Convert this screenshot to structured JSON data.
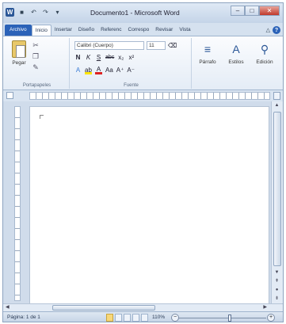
{
  "window": {
    "title": "Documento1 - Microsoft Word",
    "logo": "W",
    "qat_icons": [
      "word-logo",
      "save-icon",
      "undo-icon",
      "redo-icon",
      "customize-icon"
    ],
    "controls": {
      "minimize": "–",
      "maximize": "□",
      "close": "✕"
    }
  },
  "tabs": [
    "Archivo",
    "Inicio",
    "Insertar",
    "Diseño",
    "Referenc",
    "Correspo",
    "Revisar",
    "Vista"
  ],
  "active_tab": "Inicio",
  "ribbon": {
    "clipboard": {
      "paste_label": "Pegar",
      "group_label": "Portapapeles"
    },
    "font": {
      "name": "Calibri (Cuerpo)",
      "size": "11",
      "group_label": "Fuente",
      "row2": [
        "N",
        "K",
        "S",
        "abc",
        "x₂",
        "x²"
      ],
      "row3": [
        "A",
        "ab",
        "A",
        "Aa",
        "A⁺",
        "A⁻"
      ]
    },
    "paragraph": {
      "label": "Párrafo"
    },
    "styles": {
      "label": "Estilos"
    },
    "editing": {
      "label": "Edición"
    }
  },
  "statusbar": {
    "page": "Página: 1 de 1",
    "zoom": "110%",
    "zoom_percent": 110
  },
  "colors": {
    "file_tab": "#2b62b8",
    "ribbon_bg": "#e4ecf6",
    "window_bg": "#cfdcec"
  }
}
